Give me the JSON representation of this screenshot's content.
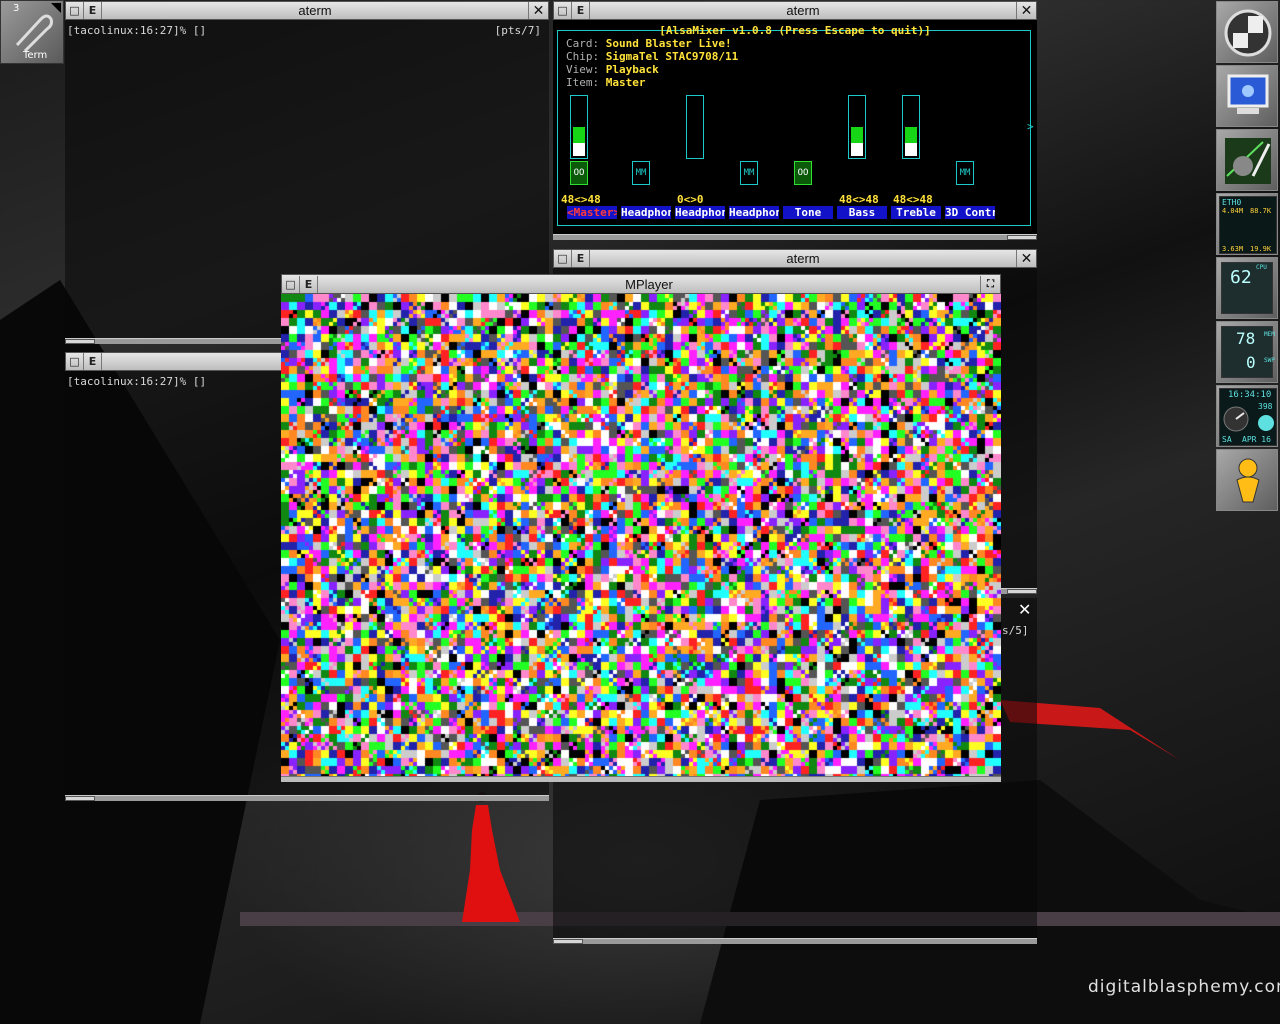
{
  "workspace": {
    "number": "3",
    "launcher_label": "Term"
  },
  "windows": {
    "aterm_top_left": {
      "title": "aterm",
      "prompt": "[tacolinux:16:27]% []",
      "pts": "[pts/7]"
    },
    "aterm_mid_left": {
      "title": "aterm",
      "prompt": "[tacolinux:16:27]% []"
    },
    "aterm_top_right": {
      "title": "aterm"
    },
    "aterm_mid_right": {
      "title": "aterm"
    },
    "aterm_hidden": {
      "pts": "s/5]"
    },
    "mplayer": {
      "title": "MPlayer"
    }
  },
  "titlebar_buttons": {
    "iconify": "□",
    "shade": "E",
    "close": "✕"
  },
  "alsamixer": {
    "header": "[AlsaMixer v1.0.8 (Press Escape to quit)]",
    "card_label": "Card:",
    "card_value": "Sound Blaster Live!",
    "chip_label": "Chip:",
    "chip_value": "SigmaTel STAC9708/11",
    "view_label": "View:",
    "view_value": "Playback",
    "item_label": "Item:",
    "item_value": "Master",
    "more_indicator": ">",
    "channels": [
      {
        "name": "Master",
        "selected": true,
        "has_bar": true,
        "fill": 0.48,
        "mute": "OO",
        "mute_on": true,
        "vol": "48<>48"
      },
      {
        "name": "Headphon",
        "selected": false,
        "has_bar": false,
        "fill": 0,
        "mute": "MM",
        "mute_on": false,
        "vol": ""
      },
      {
        "name": "Headphon",
        "selected": false,
        "has_bar": true,
        "fill": 0,
        "mute": "",
        "mute_on": false,
        "vol": "0<>0"
      },
      {
        "name": "Headphon",
        "selected": false,
        "has_bar": false,
        "fill": 0,
        "mute": "MM",
        "mute_on": false,
        "vol": ""
      },
      {
        "name": "Tone",
        "selected": false,
        "has_bar": false,
        "fill": 0,
        "mute": "OO",
        "mute_on": true,
        "vol": ""
      },
      {
        "name": "Bass",
        "selected": false,
        "has_bar": true,
        "fill": 0.48,
        "mute": "",
        "mute_on": false,
        "vol": "48<>48"
      },
      {
        "name": "Treble",
        "selected": false,
        "has_bar": true,
        "fill": 0.48,
        "mute": "",
        "mute_on": false,
        "vol": "48<>48"
      },
      {
        "name": "3D Contr",
        "selected": false,
        "has_bar": false,
        "fill": 0,
        "mute": "MM",
        "mute_on": false,
        "vol": ""
      }
    ]
  },
  "dockapps": {
    "net_iface": "ETH0",
    "net_in": "4.04M",
    "net_in2": "88.7K",
    "net_out": "3.63M",
    "net_out2": "19.9K",
    "cpu_percent": "62",
    "cpu_label": "CPU",
    "mem_percent": "78",
    "swap_percent": "0",
    "mem_label": "MEM",
    "swap_label": "SWP",
    "clock_time": "16:34:10",
    "clock_extra": "398",
    "clock_day": "SA",
    "clock_date": "APR 16"
  },
  "watermark": "digitalblasphemy.com",
  "colors": {
    "term_cyan": "#1ec8c8",
    "mixer_yellow": "#ffe23a",
    "mixer_blue": "#1212c8",
    "mixer_green": "#16d616"
  }
}
